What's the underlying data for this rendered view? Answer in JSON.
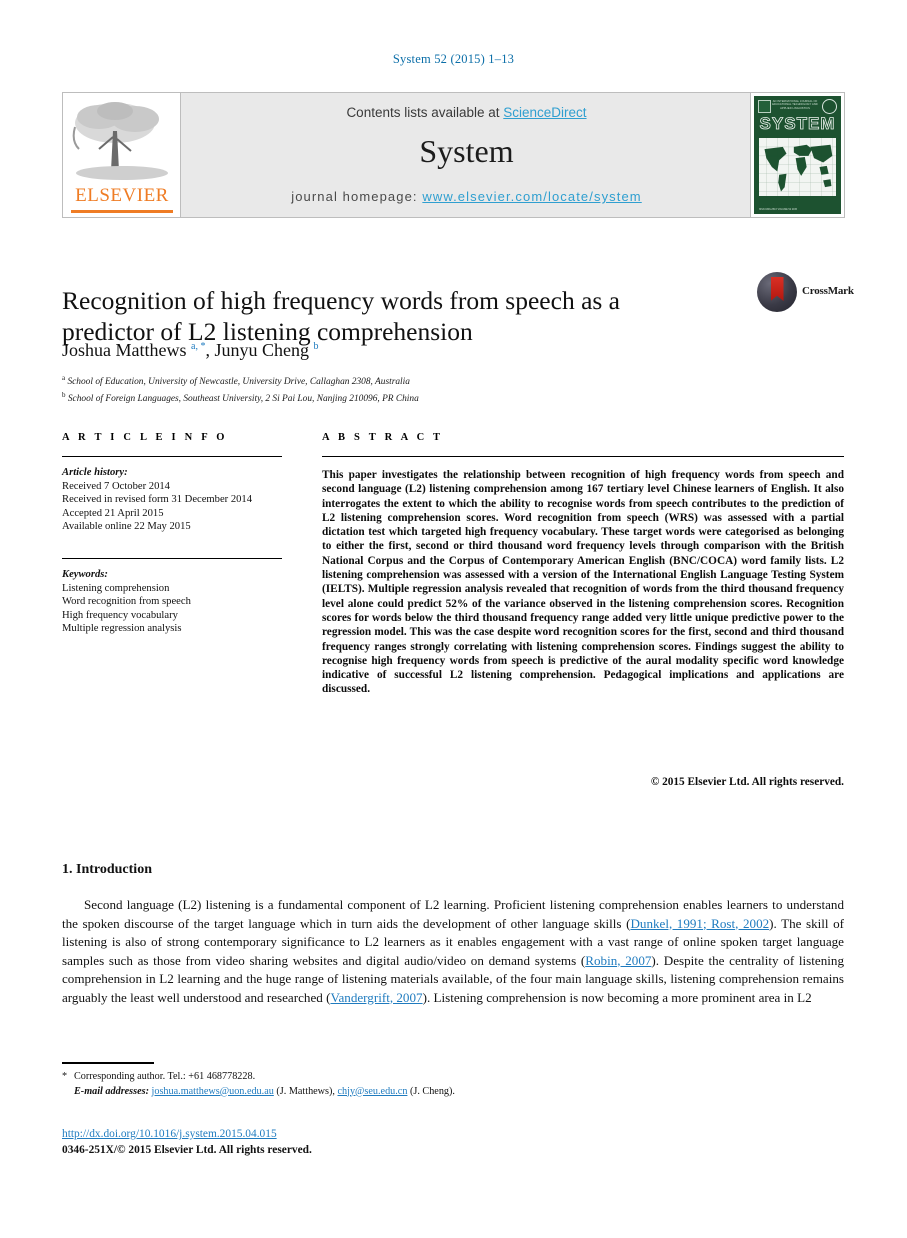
{
  "running_head": "System 52 (2015) 1–13",
  "masthead": {
    "elsevier_wordmark": "ELSEVIER",
    "contents_prefix": "Contents lists available at ",
    "sciencedirect_link": "ScienceDirect",
    "journal_title": "System",
    "homepage_prefix": "journal homepage: ",
    "homepage_link": "www.elsevier.com/locate/system",
    "cover": {
      "title": "SYSTEM",
      "top_text": "AN INTERNATIONAL JOURNAL OF EDUCATIONAL TECHNOLOGY AND APPLIED LINGUISTICS",
      "bottom_text": "ISSN 0346-251X VOLUME 52 2015"
    },
    "accent_orange": "#ef7c24",
    "link_blue": "#2f9fd0",
    "cover_green": "#1d5230"
  },
  "article": {
    "title": "Recognition of high frequency words from speech as a predictor of L2 listening comprehension",
    "authors_html": "Joshua Matthews <sup>a, *</sup>, Junyu Cheng <sup>b</sup>",
    "affiliations": [
      {
        "marker": "a",
        "text": "School of Education, University of Newcastle, University Drive, Callaghan 2308, Australia"
      },
      {
        "marker": "b",
        "text": "School of Foreign Languages, Southeast University, 2 Si Pai Lou, Nanjing 210096, PR China"
      }
    ],
    "crossmark_label": "CrossMark"
  },
  "article_info": {
    "heading": "A R T I C L E   I N F O",
    "history_label": "Article history:",
    "history": [
      "Received 7 October 2014",
      "Received in revised form 31 December 2014",
      "Accepted 21 April 2015",
      "Available online 22 May 2015"
    ],
    "keywords_label": "Keywords:",
    "keywords": [
      "Listening comprehension",
      "Word recognition from speech",
      "High frequency vocabulary",
      "Multiple regression analysis"
    ]
  },
  "abstract": {
    "heading": "A B S T R A C T",
    "text": "This paper investigates the relationship between recognition of high frequency words from speech and second language (L2) listening comprehension among 167 tertiary level Chinese learners of English. It also interrogates the extent to which the ability to recognise words from speech contributes to the prediction of L2 listening comprehension scores. Word recognition from speech (WRS) was assessed with a partial dictation test which targeted high frequency vocabulary. These target words were categorised as belonging to either the first, second or third thousand word frequency levels through comparison with the British National Corpus and the Corpus of Contemporary American English (BNC/COCA) word family lists. L2 listening comprehension was assessed with a version of the International English Language Testing System (IELTS). Multiple regression analysis revealed that recognition of words from the third thousand frequency level alone could predict 52% of the variance observed in the listening comprehension scores. Recognition scores for words below the third thousand frequency range added very little unique predictive power to the regression model. This was the case despite word recognition scores for the first, second and third thousand frequency ranges strongly correlating with listening comprehension scores. Findings suggest the ability to recognise high frequency words from speech is predictive of the aural modality specific word knowledge indicative of successful L2 listening comprehension. Pedagogical implications and applications are discussed.",
    "copyright": "© 2015 Elsevier Ltd. All rights reserved."
  },
  "introduction": {
    "heading": "1. Introduction",
    "paragraph_parts": [
      {
        "type": "text",
        "value": "Second language (L2) listening is a fundamental component of L2 learning. Proficient listening comprehension enables learners to understand the spoken discourse of the target language which in turn aids the development of other language skills ("
      },
      {
        "type": "cite",
        "value": "Dunkel, 1991; Rost, 2002"
      },
      {
        "type": "text",
        "value": "). The skill of listening is also of strong contemporary significance to L2 learners as it enables engagement with a vast range of online spoken target language samples such as those from video sharing websites and digital audio/video on demand systems ("
      },
      {
        "type": "cite",
        "value": "Robin, 2007"
      },
      {
        "type": "text",
        "value": "). Despite the centrality of listening comprehension in L2 learning and the huge range of listening materials available, of the four main language skills, listening comprehension remains arguably the least well understood and researched ("
      },
      {
        "type": "cite",
        "value": "Vandergrift, 2007"
      },
      {
        "type": "text",
        "value": "). Listening comprehension is now becoming a more prominent area in L2"
      }
    ]
  },
  "footnotes": {
    "corresponding": "Corresponding author. Tel.: +61 468778228.",
    "email_label": "E-mail addresses:",
    "emails": [
      {
        "address": "joshua.matthews@uon.edu.au",
        "owner": "(J. Matthews)"
      },
      {
        "address": "chjy@seu.edu.cn",
        "owner": "(J. Cheng)"
      }
    ],
    "doi": "http://dx.doi.org/10.1016/j.system.2015.04.015",
    "issn_line": "0346-251X/© 2015 Elsevier Ltd. All rights reserved."
  }
}
